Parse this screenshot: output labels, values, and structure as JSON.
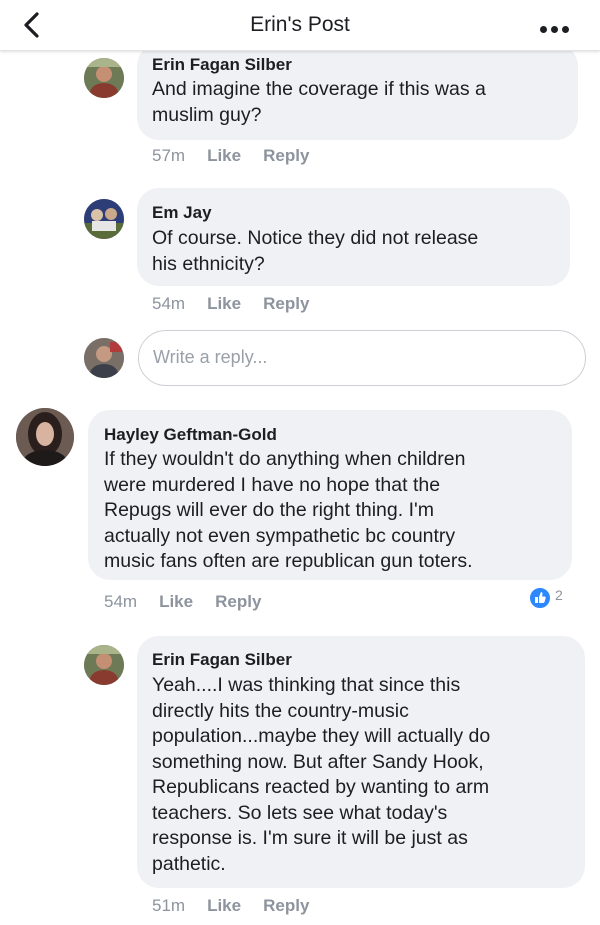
{
  "header": {
    "title": "Erin's Post"
  },
  "comments": [
    {
      "author": "Erin Fagan Silber",
      "text_lines": [
        "And imagine the coverage if this was a",
        "muslim guy?"
      ],
      "time": "57m",
      "like_label": "Like",
      "reply_label": "Reply"
    },
    {
      "author": "Em Jay",
      "text_lines": [
        "Of course. Notice they did not release",
        "his ethnicity?"
      ],
      "time": "54m",
      "like_label": "Like",
      "reply_label": "Reply"
    },
    {
      "author": "Hayley Geftman-Gold",
      "text_lines": [
        "If they wouldn't do anything when children",
        "were murdered I have no hope that the",
        "Repugs will ever do the right thing.  I'm",
        "actually not even sympathetic bc country",
        "music fans often are republican gun toters."
      ],
      "time": "54m",
      "like_label": "Like",
      "reply_label": "Reply",
      "reaction_count": "2"
    },
    {
      "author": "Erin Fagan Silber",
      "text_lines": [
        "Yeah....I was thinking that since this",
        "directly hits the country-music",
        "population...maybe they will actually do",
        "something now.  But after Sandy Hook,",
        "Republicans reacted by wanting to arm",
        "teachers.  So lets see what today's",
        "response is.  I'm sure it will be just as",
        "pathetic."
      ],
      "time": "51m",
      "like_label": "Like",
      "reply_label": "Reply"
    }
  ],
  "reply_input": {
    "placeholder": "Write a reply..."
  },
  "colors": {
    "bubble_bg": "#f0f1f5",
    "meta_text": "#8d949e",
    "like_blue": "#2d88ff"
  },
  "icons": {
    "back": "chevron-left-icon",
    "more": "more-dots-icon",
    "reaction": "like-thumb-icon"
  }
}
